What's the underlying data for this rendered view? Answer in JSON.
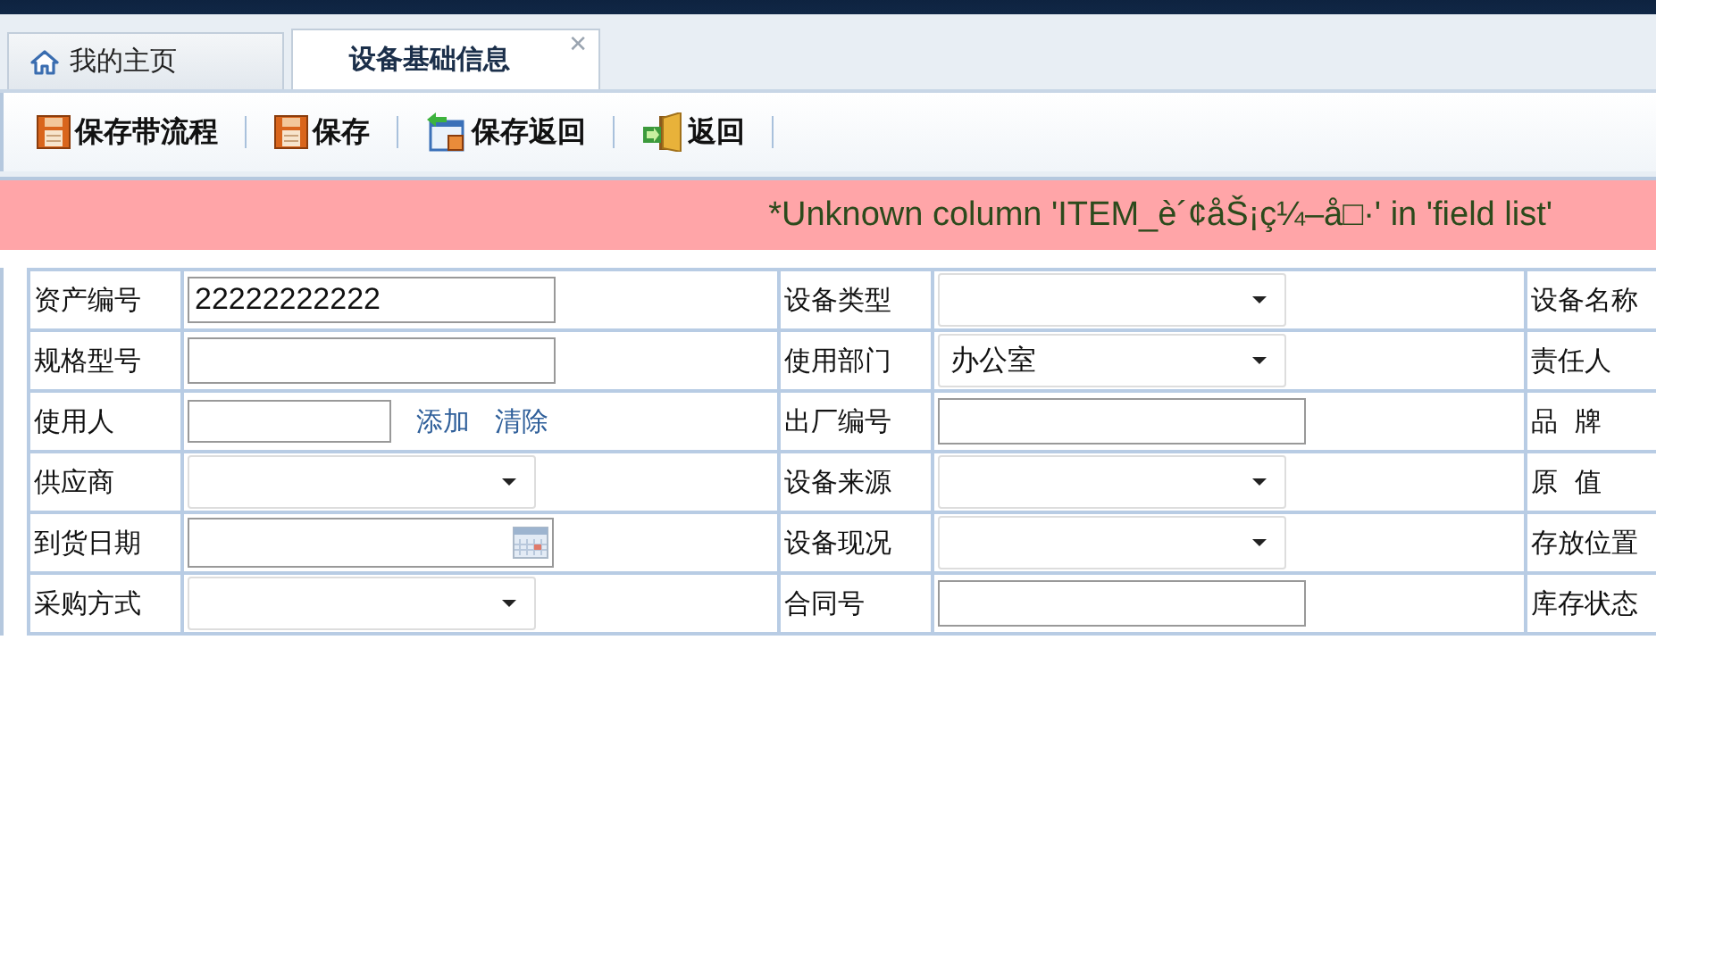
{
  "tabs": [
    {
      "label": "我的主页",
      "selected": false,
      "kind": "home"
    },
    {
      "label": "设备基础信息",
      "selected": true,
      "kind": "plain",
      "close": "✕"
    }
  ],
  "toolbar": [
    {
      "label": "保存带流程",
      "kind": "save"
    },
    {
      "label": "保存",
      "kind": "save"
    },
    {
      "label": "保存返回",
      "kind": "save-return"
    },
    {
      "label": "返回",
      "kind": "exit"
    }
  ],
  "error": "*Unknown column 'ITEM_è´¢åŠ¡ç¼–å□·' in 'field list'",
  "form_rows": [
    {
      "cells": [
        {
          "label": "资产编号",
          "field": {
            "kind": "text",
            "value": "22222222222"
          }
        },
        {
          "label": "设备类型",
          "field": {
            "kind": "select"
          }
        },
        {
          "label": "设备名称"
        }
      ]
    },
    {
      "cells": [
        {
          "label": "规格型号",
          "field": {
            "kind": "text"
          }
        },
        {
          "label": "使用部门",
          "field": {
            "kind": "select",
            "value": "办公室"
          }
        },
        {
          "label": "责任人"
        }
      ]
    },
    {
      "cells": [
        {
          "label": "使用人",
          "field": {
            "kind": "user",
            "links": [
              "添加",
              "清除"
            ]
          }
        },
        {
          "label": "出厂编号",
          "field": {
            "kind": "text"
          }
        },
        {
          "label": "品  牌"
        }
      ]
    },
    {
      "cells": [
        {
          "label": "供应商",
          "field": {
            "kind": "select"
          }
        },
        {
          "label": "设备来源",
          "field": {
            "kind": "select"
          }
        },
        {
          "label": "原  值"
        }
      ]
    },
    {
      "cells": [
        {
          "label": "到货日期",
          "field": {
            "kind": "date"
          }
        },
        {
          "label": "设备现况",
          "field": {
            "kind": "select"
          }
        },
        {
          "label": "存放位置"
        }
      ]
    },
    {
      "cells": [
        {
          "label": "采购方式",
          "field": {
            "kind": "select"
          }
        },
        {
          "label": "合同号",
          "field": {
            "kind": "text"
          }
        },
        {
          "label": "库存状态"
        }
      ]
    }
  ]
}
